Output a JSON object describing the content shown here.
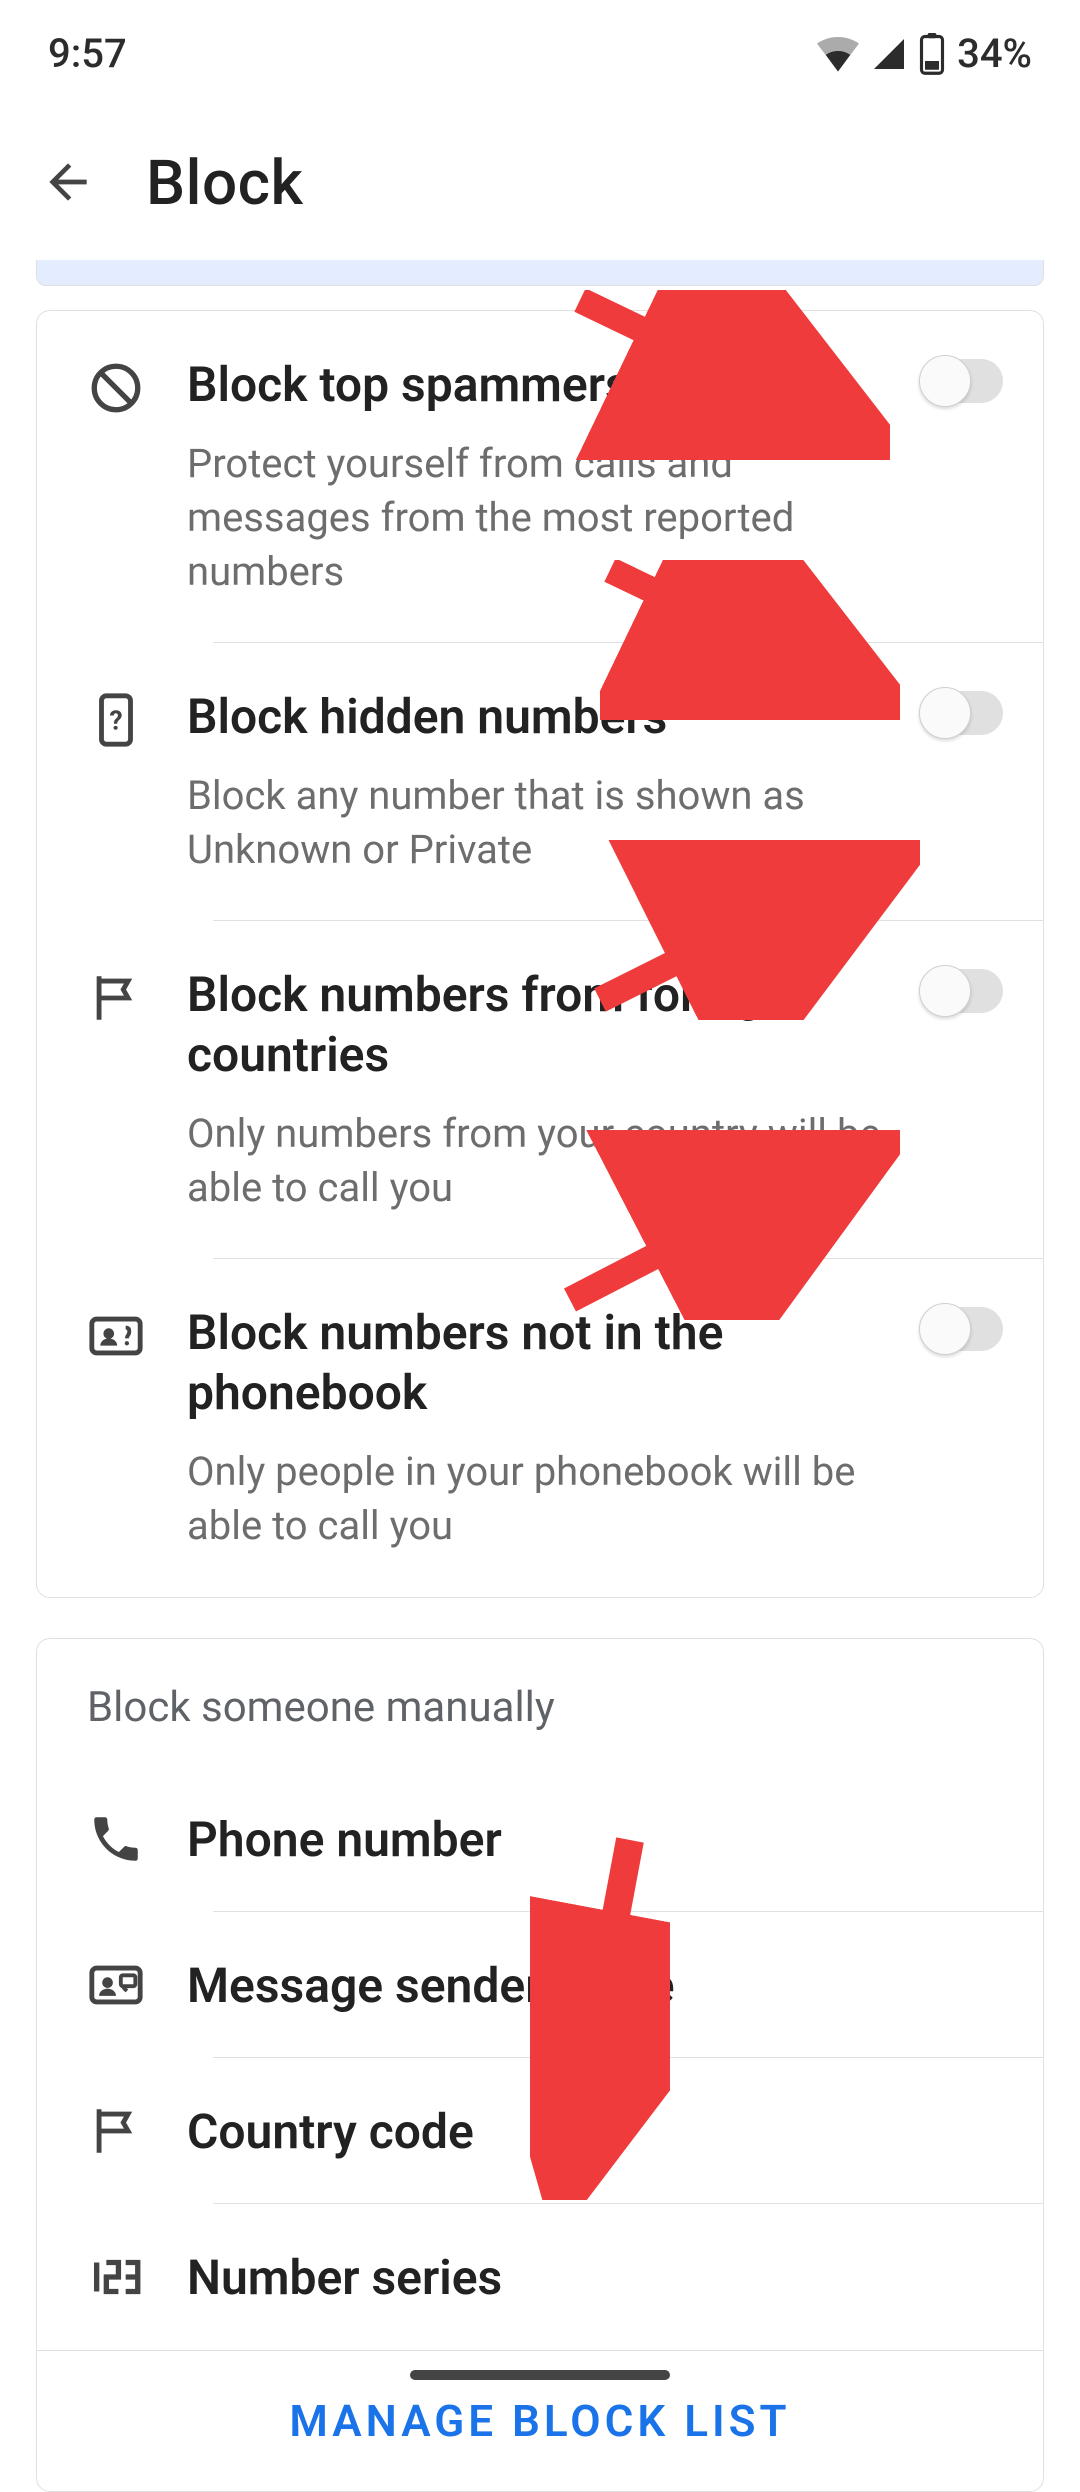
{
  "status_bar": {
    "time": "9:57",
    "battery_text": "34%"
  },
  "header": {
    "title": "Block"
  },
  "block_options": [
    {
      "title": "Block top spammers",
      "description": "Protect yourself from calls and messages from the most reported numbers",
      "enabled": false,
      "icon": "block"
    },
    {
      "title": "Block hidden numbers",
      "description": "Block any number that is shown as Unknown or Private",
      "enabled": false,
      "icon": "unknown-phone"
    },
    {
      "title": "Block numbers from foreign countries",
      "description": "Only numbers from your country will be able to call you",
      "enabled": false,
      "icon": "flag"
    },
    {
      "title": "Block numbers not in the phonebook",
      "description": "Only people in your phonebook will be able to call you",
      "enabled": false,
      "icon": "contact-card"
    }
  ],
  "manual_block": {
    "header": "Block someone manually",
    "items": [
      {
        "label": "Phone number",
        "icon": "phone"
      },
      {
        "label": "Message sender name",
        "icon": "sender-card"
      },
      {
        "label": "Country code",
        "icon": "flag"
      },
      {
        "label": "Number series",
        "icon": "number-series"
      }
    ]
  },
  "manage_link": "MANAGE BLOCK LIST"
}
